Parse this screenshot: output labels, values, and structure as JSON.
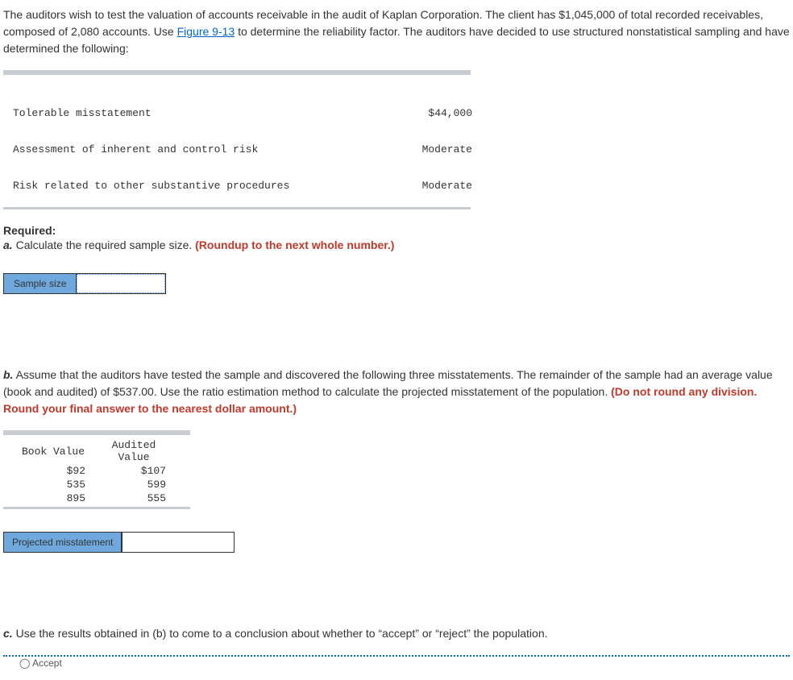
{
  "intro": {
    "text_before_link": "The auditors wish to test the valuation of accounts receivable in the audit of Kaplan Corporation. The client has $1,045,000 of total recorded receivables, composed of 2,080 accounts. Use ",
    "link_text": "Figure 9-13",
    "text_after_link": " to determine the reliability factor. The auditors have decided to use structured nonstatistical sampling and have determined the following:"
  },
  "given": {
    "rows": [
      {
        "label": "Tolerable misstatement",
        "value": "$44,000"
      },
      {
        "label": "Assessment of inherent and control risk",
        "value": "Moderate"
      },
      {
        "label": "Risk related to other substantive procedures",
        "value": "Moderate"
      }
    ]
  },
  "required_label": "Required:",
  "part_a": {
    "letter": "a.",
    "text": " Calculate the required sample size. ",
    "hint": "(Roundup to the next whole number.)",
    "input_label": "Sample size"
  },
  "part_b": {
    "letter": "b.",
    "text": " Assume that the auditors have tested the sample and discovered the following three misstatements. The remainder of the sample had an average value (book and audited) of $537.00. Use the ratio estimation method to calculate the projected misstatement of the population. ",
    "hint": "(Do not round any division. Round your final answer to the nearest dollar amount.)",
    "table": {
      "headers": [
        "Book Value",
        "Audited\nValue"
      ],
      "rows": [
        {
          "book": "$92",
          "audited": "$107"
        },
        {
          "book": "535",
          "audited": "599"
        },
        {
          "book": "895",
          "audited": "555"
        }
      ]
    },
    "input_label": "Projected misstatement"
  },
  "part_c": {
    "letter": "c.",
    "text": " Use the results obtained in (b) to come to a conclusion about whether to “accept” or “reject” the population.",
    "option_visible": "Accept"
  }
}
